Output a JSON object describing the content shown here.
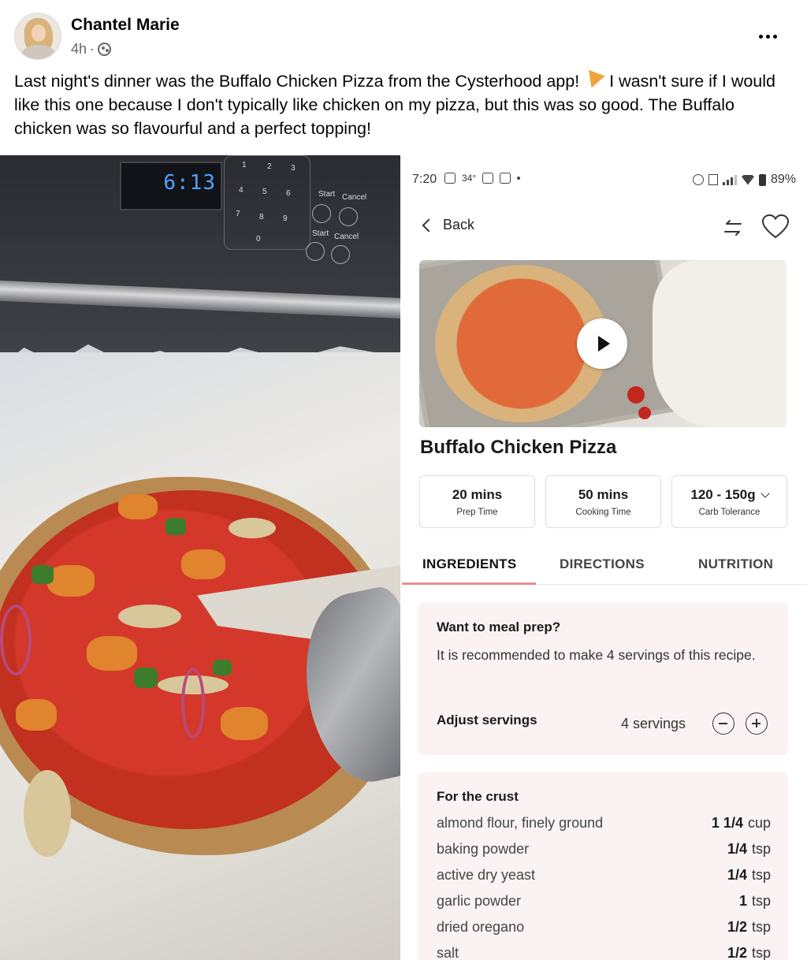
{
  "post": {
    "author": "Chantel Marie",
    "time": "4h",
    "separator": "·",
    "text_before_emoji": "Last night's dinner was the Buffalo Chicken Pizza from the Cysterhood app!",
    "emoji_icon": "pizza-icon",
    "text_after_emoji": "I wasn't sure if I would like this one because I don't typically like chicken on my pizza, but this was so good.  The Buffalo chicken was so flavourful and a perfect topping!"
  },
  "oven": {
    "display_time": "6:13",
    "keys": [
      "1",
      "2",
      "3",
      "4",
      "5",
      "6",
      "7",
      "8",
      "9",
      "0"
    ],
    "labels": [
      "Start",
      "Cancel",
      "Start",
      "Cancel"
    ]
  },
  "phone": {
    "status": {
      "time": "7:20",
      "temp": "34°",
      "battery": "89%"
    },
    "nav": {
      "back_label": "Back"
    },
    "recipe": {
      "title": "Buffalo Chicken Pizza",
      "stats": [
        {
          "value": "20 mins",
          "label": "Prep Time"
        },
        {
          "value": "50 mins",
          "label": "Cooking Time"
        },
        {
          "value": "120 - 150g",
          "label": "Carb Tolerance"
        }
      ]
    },
    "tabs": [
      "INGREDIENTS",
      "DIRECTIONS",
      "NUTRITION"
    ],
    "active_tab": "INGREDIENTS",
    "accent_color": "#e98d8d",
    "meal_prep": {
      "heading": "Want to meal prep?",
      "text": "It is recommended to make 4 servings of this recipe.",
      "adjust_label": "Adjust servings",
      "servings": "4 servings"
    },
    "ingredients": {
      "section": "For the crust",
      "items": [
        {
          "name": "almond flour, finely ground",
          "qty": "1 1/4",
          "unit": "cup"
        },
        {
          "name": "baking powder",
          "qty": "1/4",
          "unit": "tsp"
        },
        {
          "name": "active dry yeast",
          "qty": "1/4",
          "unit": "tsp"
        },
        {
          "name": "garlic powder",
          "qty": "1",
          "unit": "tsp"
        },
        {
          "name": "dried oregano",
          "qty": "1/2",
          "unit": "tsp"
        },
        {
          "name": "salt",
          "qty": "1/2",
          "unit": "tsp"
        }
      ]
    }
  }
}
